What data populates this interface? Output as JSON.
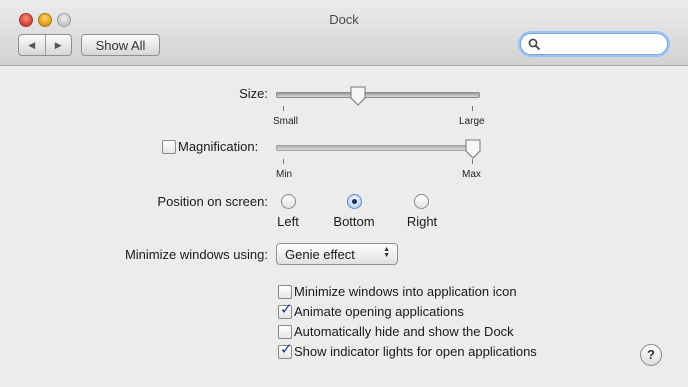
{
  "window": {
    "title": "Dock"
  },
  "toolbar": {
    "back_glyph": "◀",
    "forward_glyph": "▶",
    "show_all_label": "Show All",
    "search_value": "",
    "search_placeholder": ""
  },
  "size": {
    "label": "Size:",
    "min_label": "Small",
    "max_label": "Large",
    "value": 0.39
  },
  "magnification": {
    "label": "Magnification:",
    "checked": false,
    "min_label": "Min",
    "max_label": "Max",
    "value": 1.0
  },
  "position": {
    "label": "Position on screen:",
    "options": [
      "Left",
      "Bottom",
      "Right"
    ],
    "selected": "Bottom"
  },
  "minimize": {
    "label": "Minimize windows using:",
    "selected": "Genie effect"
  },
  "options": [
    {
      "label": "Minimize windows into application icon",
      "checked": false
    },
    {
      "label": "Animate opening applications",
      "checked": true
    },
    {
      "label": "Automatically hide and show the Dock",
      "checked": false
    },
    {
      "label": "Show indicator lights for open applications",
      "checked": true
    }
  ],
  "help": {
    "glyph": "?"
  },
  "icons": {
    "close": "close-button-icon",
    "minimize": "minimize-button-icon",
    "zoom": "zoom-button-icon",
    "search": "search-icon",
    "help": "help-icon"
  }
}
